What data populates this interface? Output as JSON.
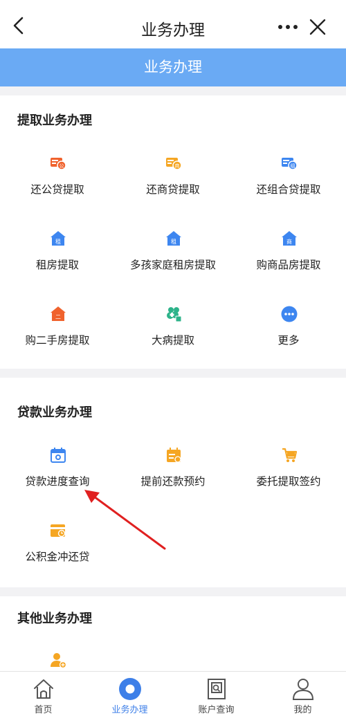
{
  "header": {
    "title": "业务办理",
    "back_icon": "chevron-left-icon",
    "more_icon": "more-dots-icon",
    "close_icon": "close-icon"
  },
  "banner": {
    "title": "业务办理"
  },
  "sections": [
    {
      "title": "提取业务办理",
      "items": [
        {
          "label": "还公贷提取",
          "icon": "card-public-icon",
          "color": "#f0622d"
        },
        {
          "label": "还商贷提取",
          "icon": "card-commercial-icon",
          "color": "#f5a623"
        },
        {
          "label": "还组合贷提取",
          "icon": "card-combo-icon",
          "color": "#3d86f0"
        },
        {
          "label": "租房提取",
          "icon": "house-rent-icon",
          "color": "#3d86f0"
        },
        {
          "label": "多孩家庭租房提取",
          "icon": "house-rent-icon",
          "color": "#3d86f0"
        },
        {
          "label": "购商品房提取",
          "icon": "house-commercial-icon",
          "color": "#3d86f0"
        },
        {
          "label": "购二手房提取",
          "icon": "house-secondhand-icon",
          "color": "#f0622d"
        },
        {
          "label": "大病提取",
          "icon": "medical-icon",
          "color": "#2db38a"
        },
        {
          "label": "更多",
          "icon": "more-circle-icon",
          "color": "#3d86f0"
        }
      ]
    },
    {
      "title": "贷款业务办理",
      "items": [
        {
          "label": "贷款进度查询",
          "icon": "calendar-progress-icon",
          "color": "#3d86f0"
        },
        {
          "label": "提前还款预约",
          "icon": "calendar-repay-icon",
          "color": "#f5a623"
        },
        {
          "label": "委托提取签约",
          "icon": "cart-sign-icon",
          "color": "#f5a623"
        },
        {
          "label": "公积金冲还贷",
          "icon": "card-clock-icon",
          "color": "#f5a623"
        }
      ]
    },
    {
      "title": "其他业务办理",
      "items": [
        {
          "label": "",
          "icon": "user-add-icon",
          "color": "#f5a623"
        }
      ]
    }
  ],
  "tabbar": [
    {
      "label": "首页",
      "icon": "home-icon",
      "active": false
    },
    {
      "label": "业务办理",
      "icon": "business-circle-icon",
      "active": true
    },
    {
      "label": "账户查询",
      "icon": "account-query-icon",
      "active": false
    },
    {
      "label": "我的",
      "icon": "profile-icon",
      "active": false
    }
  ],
  "colors": {
    "accent": "#3d7fe8",
    "banner": "#6aaaf4",
    "annotation_arrow": "#e02020"
  }
}
